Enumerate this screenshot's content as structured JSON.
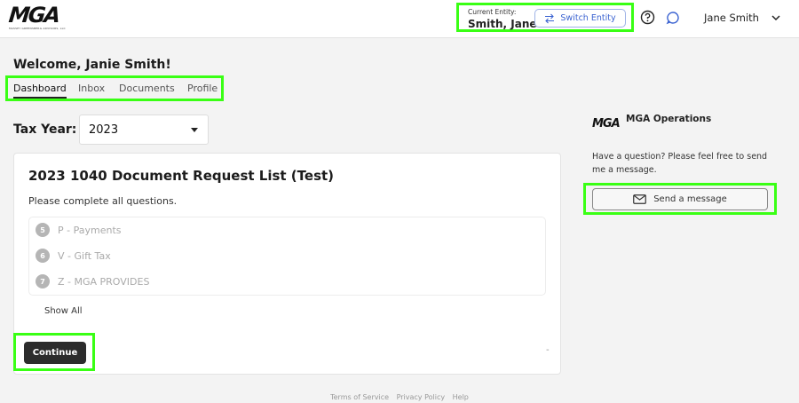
{
  "header": {
    "logo_text": "MGA",
    "logo_subtext": "MASSEY GREENSBERG ADVISORS, LLC",
    "entity_caption": "Current Entity:",
    "entity_name": "Smith, Jane",
    "switch_label": "Switch Entity",
    "user_name": "Jane Smith"
  },
  "welcome": "Welcome, Janie Smith!",
  "tabs": [
    {
      "label": "Dashboard",
      "active": true
    },
    {
      "label": "Inbox",
      "active": false
    },
    {
      "label": "Documents",
      "active": false
    },
    {
      "label": "Profile",
      "active": false
    }
  ],
  "tax_year": {
    "label": "Tax Year:",
    "value": "2023"
  },
  "card": {
    "title": "2023 1040 Document Request List (Test)",
    "instruction": "Please complete all questions.",
    "questions": [
      {
        "num": "5",
        "label": "P - Payments"
      },
      {
        "num": "6",
        "label": "V - Gift Tax"
      },
      {
        "num": "7",
        "label": "Z - MGA PROVIDES"
      }
    ],
    "show_all": "Show All",
    "continue_label": "Continue",
    "dash": "-"
  },
  "ops": {
    "logo": "MGA",
    "title": "MGA Operations",
    "text": "Have a question? Please feel free to send me a message.",
    "button": "Send a message"
  },
  "footer": {
    "terms": "Terms of Service",
    "privacy": "Privacy Policy",
    "help": "Help"
  },
  "colors": {
    "highlight": "#39ff14",
    "accent": "#3b63d1",
    "button_dark": "#2c2c2c"
  }
}
